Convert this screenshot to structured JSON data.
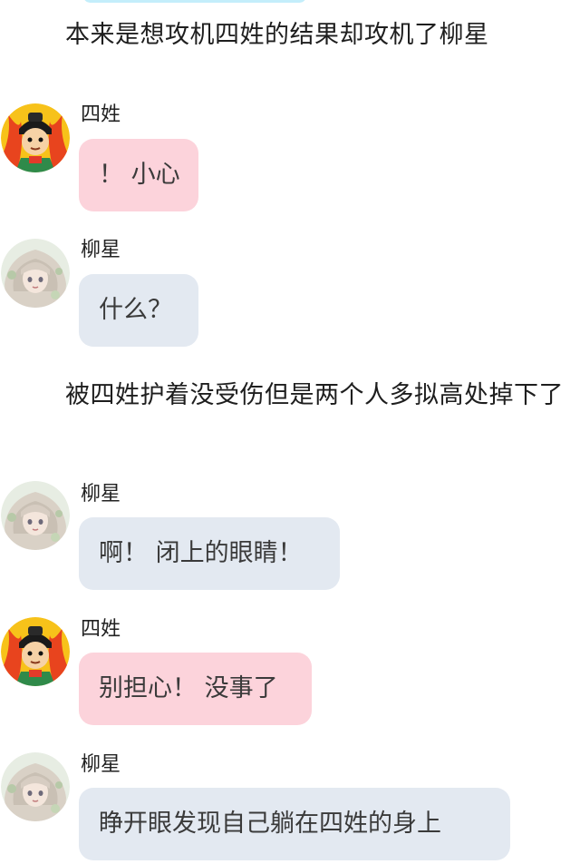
{
  "colors": {
    "pink_bubble": "#fcd3db",
    "grey_bubble": "#e3e9f1",
    "cyan_bubble": "#c4eefb"
  },
  "narration": [
    "本来是想攻机四姓的结果却攻机了柳星",
    "被四姓护着没受伤但是两个人多拟高处掉下了"
  ],
  "messages": [
    {
      "sender": "四姓",
      "text": "！ 小心",
      "avatar": "red-hair-cartoon-avatar",
      "bubble": "pink"
    },
    {
      "sender": "柳星",
      "text": "什么？",
      "avatar": "pale-hair-anime-avatar",
      "bubble": "grey"
    },
    {
      "sender": "柳星",
      "text": "啊！ 闭上的眼睛！",
      "avatar": "pale-hair-anime-avatar",
      "bubble": "grey"
    },
    {
      "sender": "四姓",
      "text": "别担心！ 没事了",
      "avatar": "red-hair-cartoon-avatar",
      "bubble": "pink"
    },
    {
      "sender": "柳星",
      "text": "睁开眼发现自己躺在四姓的身上",
      "avatar": "pale-hair-anime-avatar",
      "bubble": "grey"
    }
  ]
}
